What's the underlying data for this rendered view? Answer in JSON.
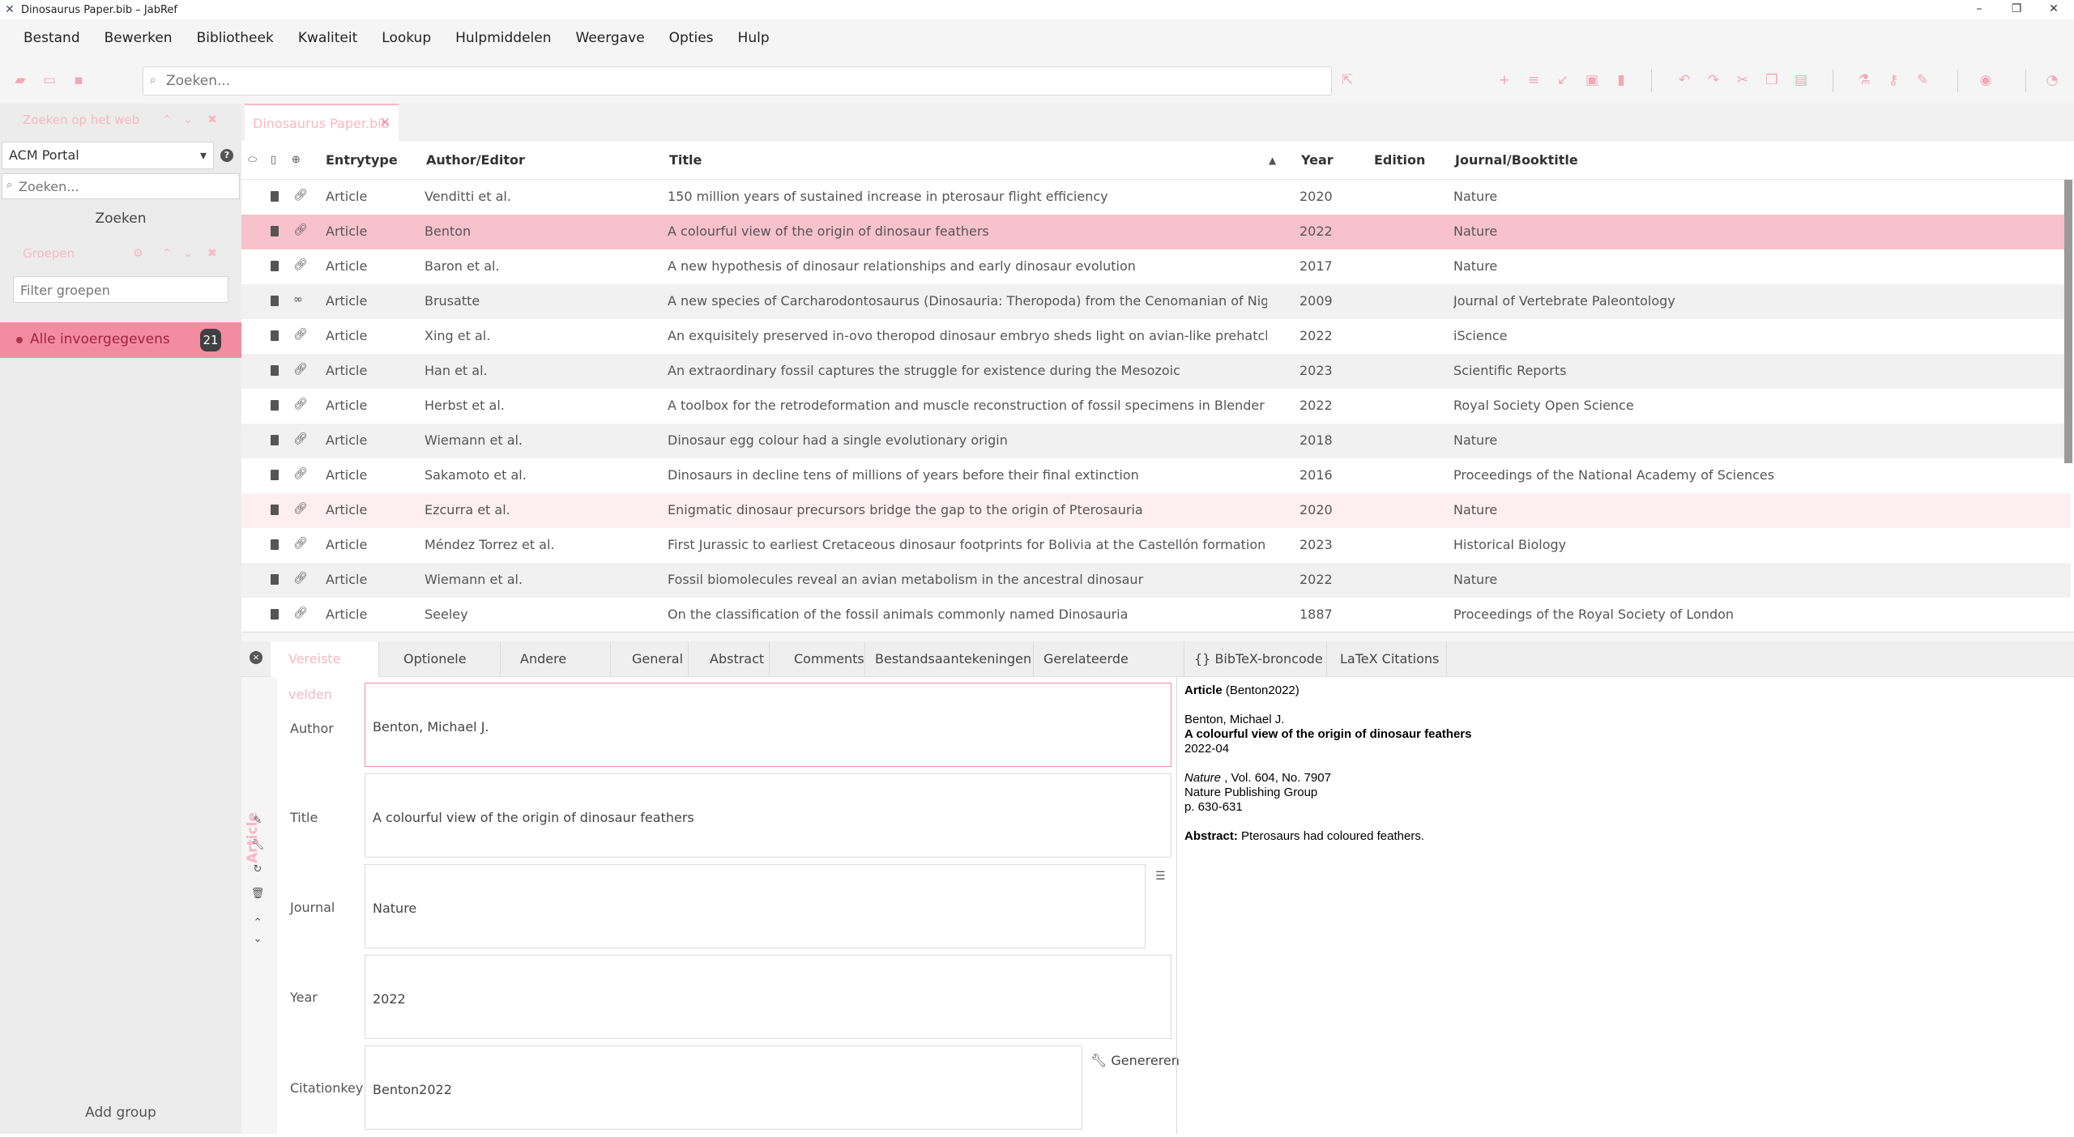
{
  "window": {
    "title": "Dinosaurus Paper.bib – JabRef"
  },
  "menu": [
    "Bestand",
    "Bewerken",
    "Bibliotheek",
    "Kwaliteit",
    "Lookup",
    "Hulpmiddelen",
    "Weergave",
    "Opties",
    "Hulp"
  ],
  "search": {
    "placeholder": "Zoeken..."
  },
  "sidebar": {
    "web_search_title": "Zoeken op het web",
    "fetcher": "ACM Portal",
    "web_search_placeholder": "Zoeken...",
    "search_button": "Zoeken",
    "groups_title": "Groepen",
    "filter_placeholder": "Filter groepen",
    "all_entries_label": "Alle invoergegevens",
    "all_entries_count": "21",
    "add_group": "Add group"
  },
  "library_tab": {
    "label": "Dinosaurus Paper.bib"
  },
  "table": {
    "columns": [
      "Entrytype",
      "Author/Editor",
      "Title",
      "Year",
      "Edition",
      "Journal/Booktitle"
    ],
    "rows": [
      {
        "type": "Article",
        "author": "Venditti et al.",
        "title": "150 million years of sustained increase in pterosaur flight efficiency",
        "year": "2020",
        "journal": "Nature"
      },
      {
        "type": "Article",
        "author": "Benton",
        "title": "A colourful view of the origin of dinosaur feathers",
        "year": "2022",
        "journal": "Nature"
      },
      {
        "type": "Article",
        "author": "Baron et al.",
        "title": "A new hypothesis of dinosaur relationships and early dinosaur evolution",
        "year": "2017",
        "journal": "Nature"
      },
      {
        "type": "Article",
        "author": "Brusatte",
        "title": "A new species of Carcharodontosaurus (Dinosauria: Theropoda) from the Cenomanian of Niger and a re...",
        "year": "2009",
        "journal": "Journal of Vertebrate Paleontology"
      },
      {
        "type": "Article",
        "author": "Xing et al.",
        "title": "An exquisitely preserved in-ovo theropod dinosaur embryo sheds light on avian-like prehatching postur...",
        "year": "2022",
        "journal": "iScience"
      },
      {
        "type": "Article",
        "author": "Han et al.",
        "title": "An extraordinary fossil captures the struggle for existence during the Mesozoic",
        "year": "2023",
        "journal": "Scientific Reports"
      },
      {
        "type": "Article",
        "author": "Herbst et al.",
        "title": "A toolbox for the retrodeformation and muscle reconstruction of fossil specimens in Blender",
        "year": "2022",
        "journal": "Royal Society Open Science"
      },
      {
        "type": "Article",
        "author": "Wiemann et al.",
        "title": "Dinosaur egg colour had a single evolutionary origin",
        "year": "2018",
        "journal": "Nature"
      },
      {
        "type": "Article",
        "author": "Sakamoto et al.",
        "title": "Dinosaurs in decline tens of millions of years before their final extinction",
        "year": "2016",
        "journal": "Proceedings of the National Academy of Sciences"
      },
      {
        "type": "Article",
        "author": "Ezcurra et al.",
        "title": "Enigmatic dinosaur precursors bridge the gap to the origin of Pterosauria",
        "year": "2020",
        "journal": "Nature"
      },
      {
        "type": "Article",
        "author": "Méndez Torrez et al.",
        "title": "First Jurassic to earliest Cretaceous dinosaur footprints for Bolivia at the Castellón formation (Tacurú Gro...",
        "year": "2023",
        "journal": "Historical Biology"
      },
      {
        "type": "Article",
        "author": "Wiemann et al.",
        "title": "Fossil biomolecules reveal an avian metabolism in the ancestral dinosaur",
        "year": "2022",
        "journal": "Nature"
      },
      {
        "type": "Article",
        "author": "Seeley",
        "title": "On the classification of the fossil animals commonly named Dinosauria",
        "year": "1887",
        "journal": "Proceedings of the Royal Society of London"
      }
    ]
  },
  "editor": {
    "tabs": [
      "Vereiste velden",
      "Optionele velden",
      "Andere velden",
      "General",
      "Abstract",
      "Comments",
      "Bestandsaantekeningen",
      "Gerelateerde artikelen",
      "{} BibTeX-broncode",
      "LaTeX Citations"
    ],
    "entry_type": "Article",
    "fields": [
      {
        "label": "Author",
        "value": "Benton, Michael J."
      },
      {
        "label": "Title",
        "value": "A colourful view of the origin of dinosaur feathers"
      },
      {
        "label": "Journal",
        "value": "Nature"
      },
      {
        "label": "Year",
        "value": "2022"
      },
      {
        "label": "Citationkey",
        "value": "Benton2022"
      }
    ],
    "generate_button": "Genereren"
  },
  "preview": {
    "type": "Article",
    "key": "(Benton2022)",
    "author": "Benton, Michael J.",
    "title": "A colourful view of the origin of dinosaur feathers",
    "date": "2022-04",
    "journal": "Nature",
    "volume_issue": " , Vol. 604, No. 7907",
    "publisher": "Nature Publishing Group",
    "pages": "p. 630-631",
    "abstract_label": "Abstract:",
    "abstract": " Pterosaurs had coloured feathers."
  },
  "colors": {
    "accent": "#f48ca1",
    "accent_light": "#f8b7c3",
    "selected_row": "#f7c2cc"
  }
}
